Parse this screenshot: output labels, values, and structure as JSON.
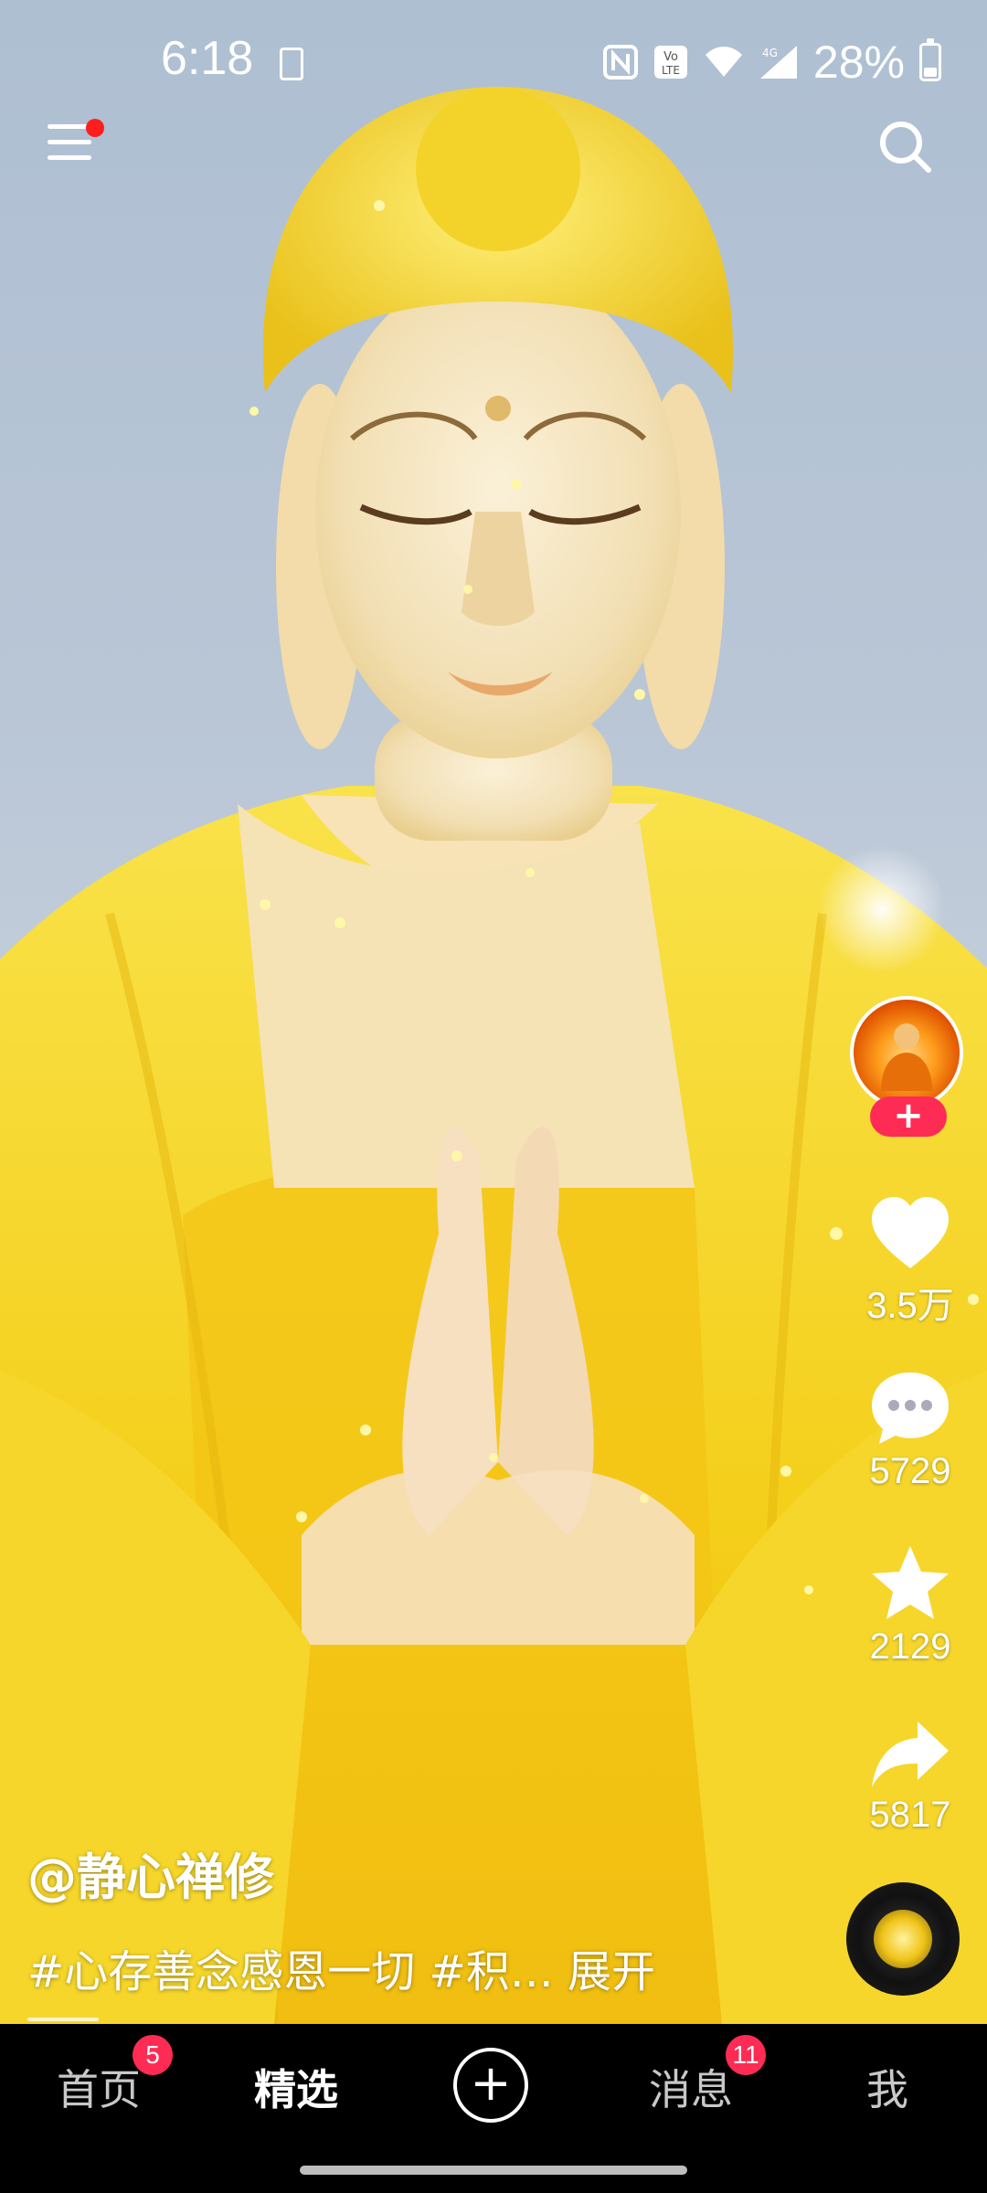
{
  "status_bar": {
    "time": "6:18",
    "battery_percent": "28%",
    "battery_level": 0.28,
    "icons": [
      "download-icon",
      "nfc-icon",
      "volte-icon",
      "wifi-icon",
      "4g-signal-icon",
      "battery-icon"
    ]
  },
  "video": {
    "subject": "golden-buddha-statue-image"
  },
  "right_rail": {
    "likes": "3.5万",
    "comments": "5729",
    "favorites": "2129",
    "shares": "5817",
    "follow_label": "+"
  },
  "caption": {
    "author": "@静心禅修",
    "description": "#心存善念感恩一切 #积…",
    "expand_label": "展开"
  },
  "bottom_nav": {
    "home": "首页",
    "home_badge": "5",
    "featured": "精选",
    "add_label": "+",
    "messages": "消息",
    "messages_badge": "11",
    "me": "我"
  },
  "colors": {
    "accent": "#fe2c55",
    "menu_dot": "#ff1e1e",
    "robe": "#f7d21c"
  }
}
